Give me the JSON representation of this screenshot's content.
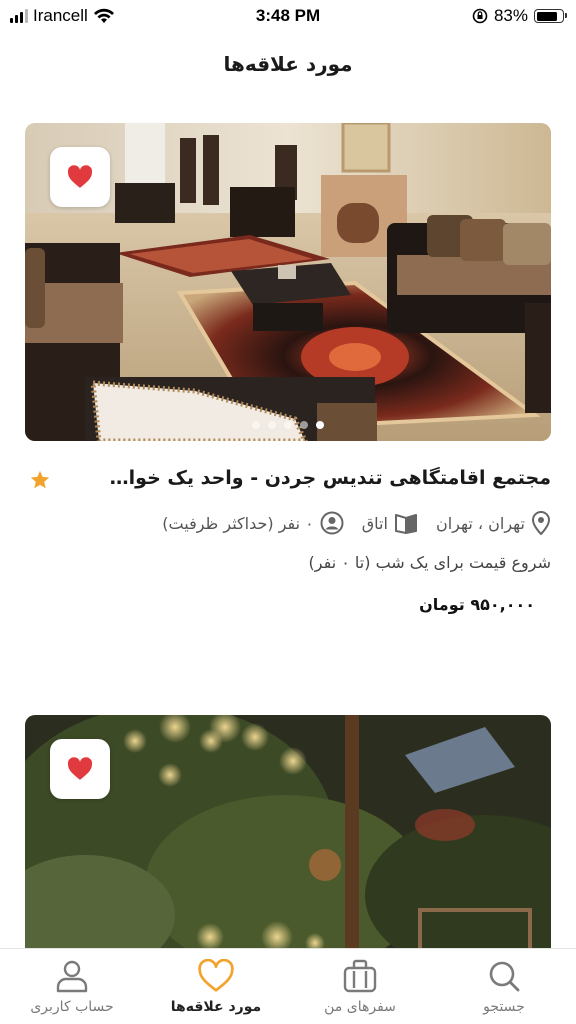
{
  "status_bar": {
    "carrier": "Irancell",
    "time": "3:48 PM",
    "battery_percent": "83%",
    "battery_level": 0.83
  },
  "header": {
    "title": "مورد علاقه‌ها"
  },
  "listings": [
    {
      "title": "مجتمع اقامتگاهی تندیس جردن - واحد یک خواب...",
      "location": "تهران ، تهران",
      "room_type": "اتاق",
      "capacity": "۰ نفر (حداکثر ظرفیت)",
      "price_caption": "شروع قیمت برای یک شب (تا ۰ نفر)",
      "price": "۹۵۰,۰۰۰ تومان",
      "favorited": true,
      "icons": {
        "favorite": "heart-icon",
        "rating": "star-icon",
        "location": "location-pin-icon",
        "room": "book-icon",
        "capacity": "user-circle-icon"
      }
    },
    {
      "favorited": true,
      "icons": {
        "favorite": "heart-icon"
      }
    }
  ],
  "tab_bar": {
    "tabs": [
      {
        "label": "حساب کاربری",
        "icon": "user-icon"
      },
      {
        "label": "مورد علاقه‌ها",
        "icon": "heart-outline-icon",
        "active": true
      },
      {
        "label": "سفرهای من",
        "icon": "suitcase-icon"
      },
      {
        "label": "جستجو",
        "icon": "search-icon"
      }
    ]
  },
  "colors": {
    "accent_red": "#e0393e",
    "star_orange": "#f2a32c",
    "active_tab_icon": "#f2a32c"
  }
}
